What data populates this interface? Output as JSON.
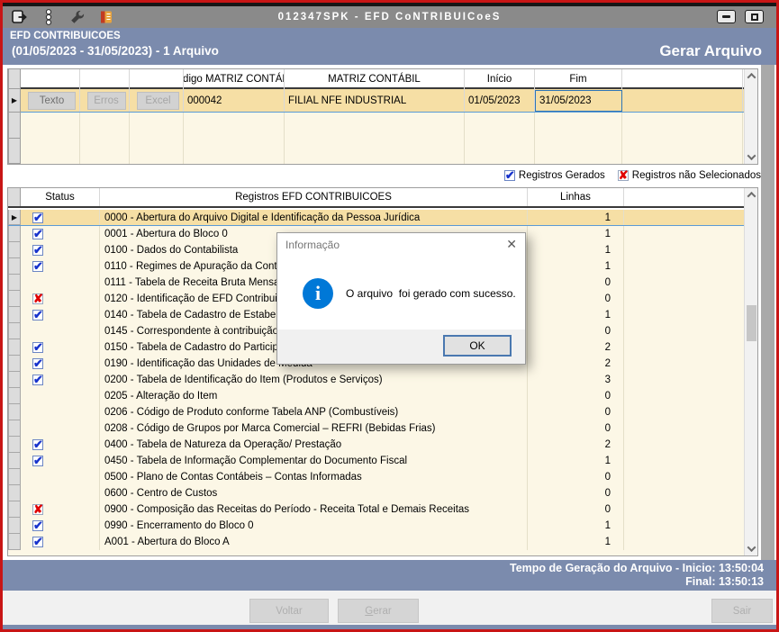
{
  "titlebar": {
    "title": "012347SPK - EFD CoNTRIBUICoeS",
    "icons": [
      "exit-icon",
      "traffic-light-icon",
      "wrench-icon",
      "book-icon"
    ]
  },
  "header": {
    "app_name": "EFD CONTRIBUICOES",
    "period": "(01/05/2023 - 31/05/2023) - 1 Arquivo",
    "action": "Gerar Arquivo"
  },
  "file_grid": {
    "columns": [
      "",
      "",
      "",
      "Código MATRIZ CONTÁBIL",
      "MATRIZ CONTÁBIL",
      "Início",
      "Fim",
      ""
    ],
    "row": {
      "texto": "Texto",
      "erros": "Erros",
      "excel": "Excel",
      "codigo": "000042",
      "matriz": "FILIAL NFE INDUSTRIAL",
      "inicio": "01/05/2023",
      "fim": "31/05/2023"
    }
  },
  "legend": {
    "gerados": "Registros Gerados",
    "nao_selecionados": "Registros não Selecionados"
  },
  "records_table": {
    "headers": {
      "status": "Status",
      "registros": "Registros EFD CONTRIBUICOES",
      "linhas": "Linhas"
    },
    "rows": [
      {
        "status": "checked",
        "label": "0000 - Abertura do Arquivo Digital e Identificação da Pessoa Jurídica",
        "linhas": "1",
        "selected": true
      },
      {
        "status": "checked",
        "label": "0001 - Abertura do Bloco 0",
        "linhas": "1"
      },
      {
        "status": "checked",
        "label": "0100 - Dados do Contabilista",
        "linhas": "1"
      },
      {
        "status": "checked",
        "label": "0110 - Regimes de Apuração da Contribuição So",
        "linhas": "1"
      },
      {
        "status": "none",
        "label": "0111 - Tabela de Receita Bruta Mensal para Fins",
        "linhas": "0"
      },
      {
        "status": "rejected",
        "label": "0120 - Identificação de EFD Contribuições sem D",
        "linhas": "0"
      },
      {
        "status": "checked",
        "label": "0140 - Tabela de Cadastro de Estabelecimento",
        "linhas": "1"
      },
      {
        "status": "none",
        "label": "0145 - Correspondente à contribuição previdenc",
        "linhas": "0"
      },
      {
        "status": "checked",
        "label": "0150 - Tabela de Cadastro do Participante",
        "linhas": "2"
      },
      {
        "status": "checked",
        "label": "0190 - Identificação das Unidades de Medida",
        "linhas": "2"
      },
      {
        "status": "checked",
        "label": "0200 - Tabela de Identificação do Item (Produtos e Serviços)",
        "linhas": "3"
      },
      {
        "status": "none",
        "label": "0205 - Alteração do Item",
        "linhas": "0"
      },
      {
        "status": "none",
        "label": "0206 - Código de Produto conforme Tabela ANP (Combustíveis)",
        "linhas": "0"
      },
      {
        "status": "none",
        "label": "0208 - Código de Grupos por Marca Comercial – REFRI (Bebidas Frias)",
        "linhas": "0"
      },
      {
        "status": "checked",
        "label": "0400 - Tabela de Natureza da Operação/ Prestação",
        "linhas": "2"
      },
      {
        "status": "checked",
        "label": "0450 - Tabela de Informação Complementar do Documento Fiscal",
        "linhas": "1"
      },
      {
        "status": "none",
        "label": "0500 - Plano de Contas Contábeis – Contas Informadas",
        "linhas": "0"
      },
      {
        "status": "none",
        "label": "0600 - Centro de Custos",
        "linhas": "0"
      },
      {
        "status": "rejected",
        "label": "0900 - Composição das Receitas do Período - Receita Total e Demais Receitas",
        "linhas": "0"
      },
      {
        "status": "checked",
        "label": "0990 - Encerramento do Bloco 0",
        "linhas": "1"
      },
      {
        "status": "checked",
        "label": "A001 - Abertura do Bloco A",
        "linhas": "1"
      }
    ]
  },
  "dialog": {
    "title": "Informação",
    "message": "O arquivo  foi gerado com sucesso.",
    "ok": "OK"
  },
  "footer": {
    "line1": "Tempo de Geração do Arquivo - Inicio: 13:50:04",
    "line2": "Final: 13:50:13"
  },
  "actions": {
    "voltar": "Voltar",
    "gerar_initial": "G",
    "gerar_rest": "erar",
    "sair": "Sair"
  },
  "colors": {
    "window_border": "#C81515",
    "titlebar": "#8A8A8A",
    "header_bar": "#7B8BAD",
    "selected_row": "#F6DFA5",
    "row_cream": "#FCF7E6",
    "check_blue": "#1733CC",
    "reject_red": "#E00000",
    "dialog_info_blue": "#0078D7"
  }
}
